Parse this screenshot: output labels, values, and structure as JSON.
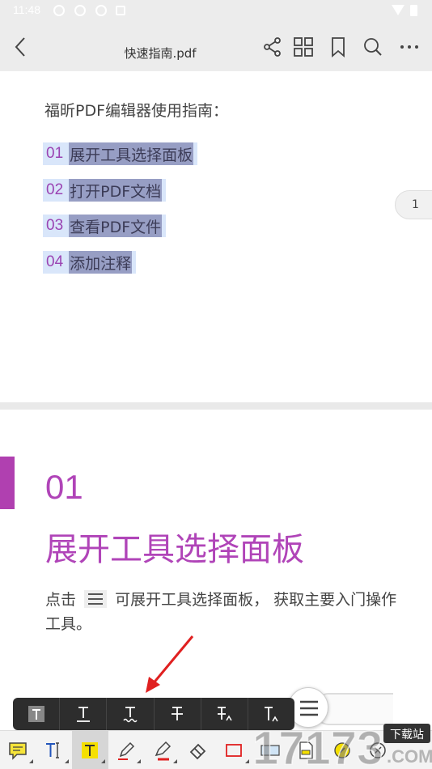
{
  "status_bar": {
    "time": "11:48"
  },
  "toolbar": {
    "title": "快速指南.pdf",
    "icons": [
      "back-icon",
      "share-icon",
      "thumbnail-grid-icon",
      "bookmark-icon",
      "search-icon",
      "more-icon"
    ]
  },
  "page1": {
    "heading": "福昕PDF编辑器使用指南：",
    "items": [
      {
        "num": "01",
        "text": "展开工具选择面板"
      },
      {
        "num": "02",
        "text": "打开PDF文档"
      },
      {
        "num": "03",
        "text": "查看PDF文件"
      },
      {
        "num": "04",
        "text": "添加注释"
      }
    ]
  },
  "page_indicator": "1",
  "page2": {
    "section_num": "01",
    "section_title": "展开工具选择面板",
    "body_pre": "点击",
    "body_post": "可展开工具选择面板， 获取主要入门操作工具。"
  },
  "watermark": {
    "text": "下载站",
    "number": "17173",
    "com": ".COM"
  },
  "colors": {
    "accent": "#b044b8",
    "highlight": "#d9e6fa",
    "toolbar_bg": "#ececec",
    "popup_bg": "#2d2d2d",
    "arrow": "#e02020"
  }
}
